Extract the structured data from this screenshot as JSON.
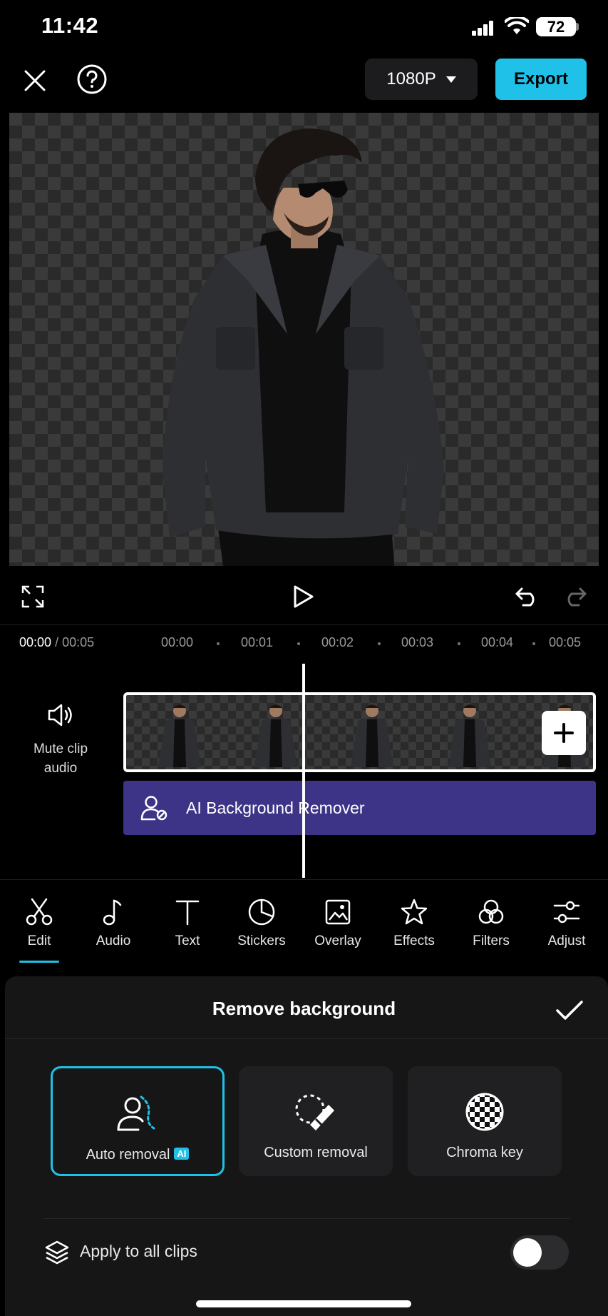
{
  "status_bar": {
    "time": "11:42",
    "battery": "72"
  },
  "top_bar": {
    "quality": "1080P",
    "export_label": "Export"
  },
  "timeline": {
    "current_time": "00:00",
    "total_time": "/ 00:05",
    "ticks": [
      "00:00",
      "00:01",
      "00:02",
      "00:03",
      "00:04",
      "00:05"
    ],
    "mute_label_line1": "Mute clip",
    "mute_label_line2": "audio",
    "effect_label": "AI Background Remover"
  },
  "toolbar": {
    "items": [
      {
        "label": "Edit",
        "icon": "scissors-icon",
        "active": true
      },
      {
        "label": "Audio",
        "icon": "music-note-icon"
      },
      {
        "label": "Text",
        "icon": "text-icon"
      },
      {
        "label": "Stickers",
        "icon": "sticker-icon"
      },
      {
        "label": "Overlay",
        "icon": "overlay-icon"
      },
      {
        "label": "Effects",
        "icon": "star-icon"
      },
      {
        "label": "Filters",
        "icon": "filters-icon"
      },
      {
        "label": "Adjust",
        "icon": "sliders-icon"
      }
    ]
  },
  "sheet": {
    "title": "Remove background",
    "options": [
      {
        "label": "Auto removal",
        "badge": "AI",
        "selected": true
      },
      {
        "label": "Custom removal"
      },
      {
        "label": "Chroma key"
      }
    ],
    "apply_all_label": "Apply to all clips",
    "apply_all_enabled": false
  },
  "colors": {
    "accent": "#1fc1e8",
    "effect_bar": "#3d3488",
    "background": "#000000"
  }
}
